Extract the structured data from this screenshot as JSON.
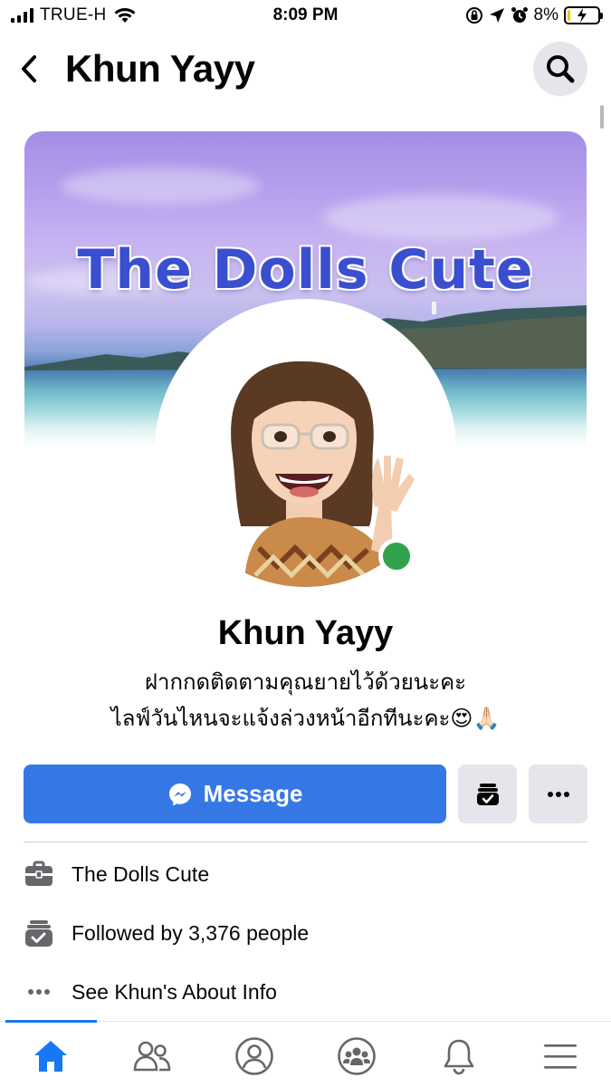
{
  "status_bar": {
    "carrier": "TRUE-H",
    "time": "8:09 PM",
    "battery_percent": "8%",
    "battery_level": 0.08,
    "icons": [
      "signal-icon",
      "wifi-icon",
      "orientation-lock-icon",
      "location-icon",
      "alarm-icon",
      "battery-icon"
    ]
  },
  "header": {
    "title": "Khun Yayy",
    "back_icon": "chevron-left-icon",
    "search_icon": "search-icon"
  },
  "cover": {
    "text": "The Dolls Cute"
  },
  "profile": {
    "name": "Khun Yayy",
    "bio_line1": "ฝากกดติดตามคุณยายไว้ด้วยนะคะ",
    "bio_line2": "ไลฟ์วันไหนจะแจ้งล่วงหน้าอีกทีนะคะ😍🙏🏻",
    "online": true
  },
  "actions": {
    "message_label": "Message",
    "message_icon": "messenger-icon",
    "follow_icon": "following-check-icon",
    "more_icon": "more-horizontal-icon"
  },
  "info": [
    {
      "icon": "briefcase-icon",
      "text": "The Dolls Cute"
    },
    {
      "icon": "followers-icon",
      "text": "Followed by 3,376 people"
    },
    {
      "icon": "more-horizontal-icon",
      "text": "See Khun's About Info"
    }
  ],
  "bottom_nav": [
    {
      "icon": "home-icon",
      "active": true
    },
    {
      "icon": "friends-icon",
      "active": false
    },
    {
      "icon": "profile-icon",
      "active": false
    },
    {
      "icon": "groups-icon",
      "active": false
    },
    {
      "icon": "bell-icon",
      "active": false
    },
    {
      "icon": "menu-icon",
      "active": false
    }
  ],
  "colors": {
    "accent": "#1877f2",
    "message_button": "#3578e5",
    "secondary_button": "#e4e6eb",
    "online": "#31a24c",
    "cover_title": "#3a4fcf"
  }
}
